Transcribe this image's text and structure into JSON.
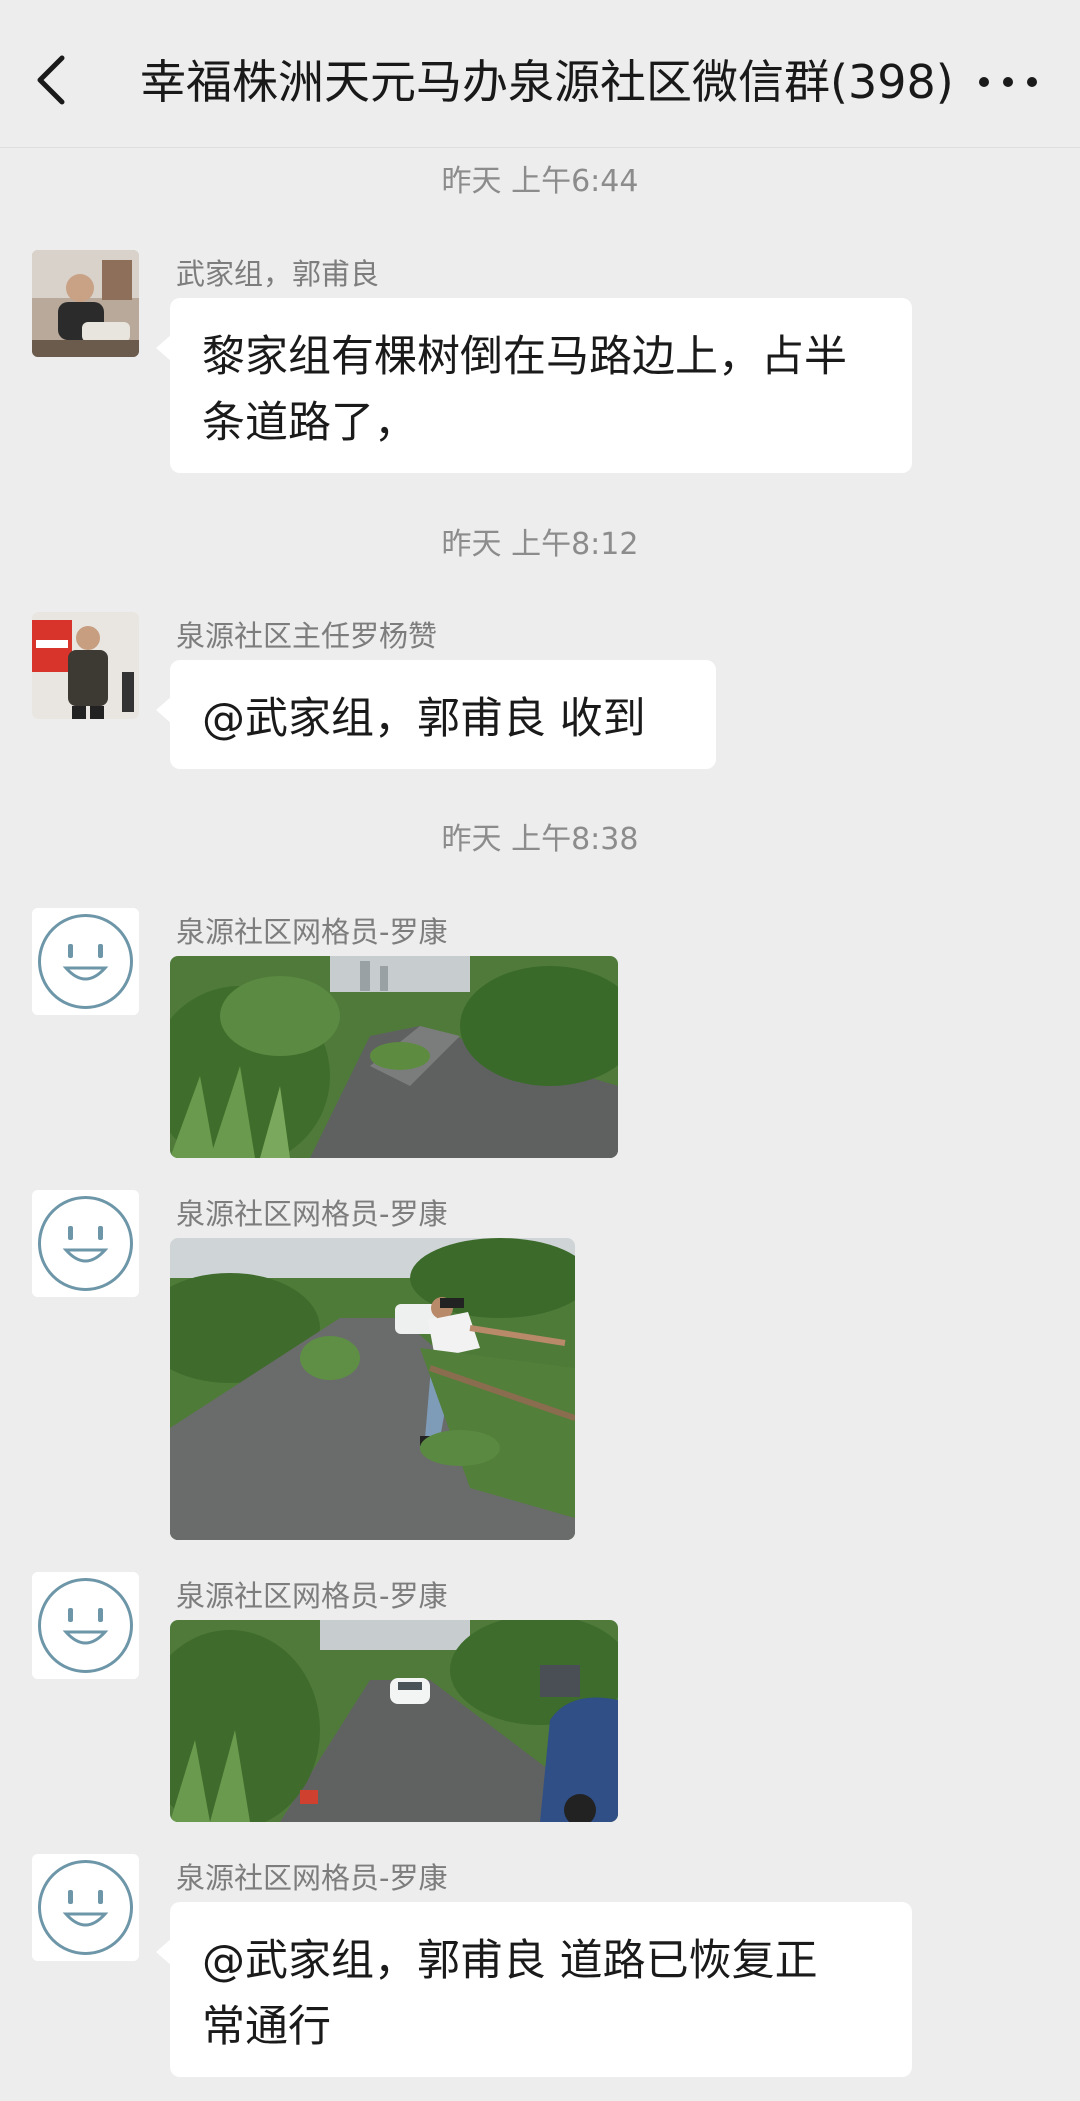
{
  "header": {
    "title": "幸福株洲天元马办泉源社区微信群(398)",
    "back_icon": "chevron-left-icon",
    "more_icon": "more-dots-icon"
  },
  "timestamps": [
    "昨天 上午6:44",
    "昨天 上午8:12",
    "昨天 上午8:38"
  ],
  "messages": [
    {
      "sender": "武家组，郭甫良",
      "text_line1": "黎家组有棵树倒在马路边上，占半",
      "text_line2": "条道路了，"
    },
    {
      "sender": "泉源社区主任罗杨赞",
      "text": "@武家组，郭甫良  收到"
    },
    {
      "sender": "泉源社区网格员-罗康",
      "type": "image",
      "image": "flooded road with fallen tree"
    },
    {
      "sender": "泉源社区网格员-罗康",
      "type": "image",
      "image": "man clearing fallen tree on road"
    },
    {
      "sender": "泉源社区网格员-罗康",
      "type": "image",
      "image": "road with cars after clearing"
    },
    {
      "sender": "泉源社区网格员-罗康",
      "text_line1": "@武家组，郭甫良  道路已恢复正",
      "text_line2": "常通行"
    }
  ],
  "colors": {
    "background": "#ededed",
    "bubble": "#ffffff",
    "meta_text": "#8c8c8c"
  }
}
